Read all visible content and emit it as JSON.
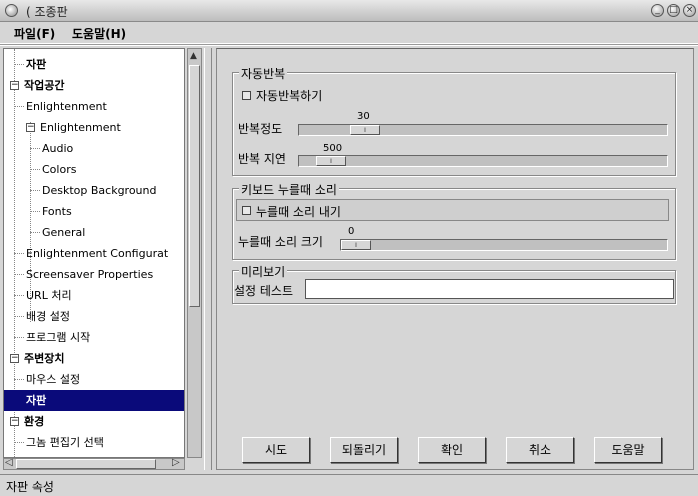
{
  "window": {
    "title": "조종판",
    "buttons": [
      "minimize",
      "maximize",
      "close"
    ]
  },
  "menu": {
    "file": "파일(F)",
    "help": "도움말(H)"
  },
  "tree": {
    "items": [
      {
        "label": "자판",
        "level": 1,
        "expander": "",
        "bold": true,
        "selected": false
      },
      {
        "label": "작업공간",
        "level": 0,
        "expander": "−",
        "bold": true,
        "selected": false
      },
      {
        "label": "Enlightenment",
        "level": 1,
        "expander": "",
        "bold": false,
        "selected": false
      },
      {
        "label": "Enlightenment",
        "level": 1,
        "expander": "−",
        "bold": false,
        "selected": false
      },
      {
        "label": "Audio",
        "level": 2,
        "expander": "",
        "bold": false,
        "selected": false
      },
      {
        "label": "Colors",
        "level": 2,
        "expander": "",
        "bold": false,
        "selected": false
      },
      {
        "label": "Desktop Background",
        "level": 2,
        "expander": "",
        "bold": false,
        "selected": false
      },
      {
        "label": "Fonts",
        "level": 2,
        "expander": "",
        "bold": false,
        "selected": false
      },
      {
        "label": "General",
        "level": 2,
        "expander": "",
        "bold": false,
        "selected": false
      },
      {
        "label": "Enlightenment Configurat",
        "level": 1,
        "expander": "",
        "bold": false,
        "selected": false
      },
      {
        "label": "Screensaver Properties",
        "level": 1,
        "expander": "",
        "bold": false,
        "selected": false
      },
      {
        "label": "URL 처리",
        "level": 1,
        "expander": "",
        "bold": false,
        "selected": false
      },
      {
        "label": "배경 설정",
        "level": 1,
        "expander": "",
        "bold": false,
        "selected": false
      },
      {
        "label": "프로그램 시작",
        "level": 1,
        "expander": "",
        "bold": false,
        "selected": false
      },
      {
        "label": "주변장치",
        "level": 0,
        "expander": "−",
        "bold": true,
        "selected": false
      },
      {
        "label": "마우스 설정",
        "level": 1,
        "expander": "",
        "bold": false,
        "selected": false
      },
      {
        "label": "자판",
        "level": 1,
        "expander": "",
        "bold": true,
        "selected": true
      },
      {
        "label": "환경",
        "level": 0,
        "expander": "−",
        "bold": true,
        "selected": false
      },
      {
        "label": "그놈 편집기 선택",
        "level": 1,
        "expander": "",
        "bold": false,
        "selected": false
      }
    ]
  },
  "autorepeat": {
    "group_title": "자동반복",
    "checkbox_label": "자동반복하기",
    "checked": false,
    "rate_label": "반복정도",
    "rate_value": "30",
    "rate_fraction": 0.15,
    "delay_label": "반복 지연",
    "delay_value": "500",
    "delay_fraction": 0.05
  },
  "click_sound": {
    "group_title": "키보드 누를때 소리",
    "checkbox_label": "누를때 소리 내기",
    "checked": false,
    "volume_label": "누를때 소리 크기",
    "volume_value": "0",
    "volume_fraction": 0.0
  },
  "preview": {
    "group_title": "미리보기",
    "test_label": "설정 테스트",
    "test_value": ""
  },
  "buttons": {
    "try": "시도",
    "revert": "되돌리기",
    "ok": "확인",
    "cancel": "취소",
    "help": "도움말"
  },
  "status": {
    "text": "자판 속성"
  }
}
